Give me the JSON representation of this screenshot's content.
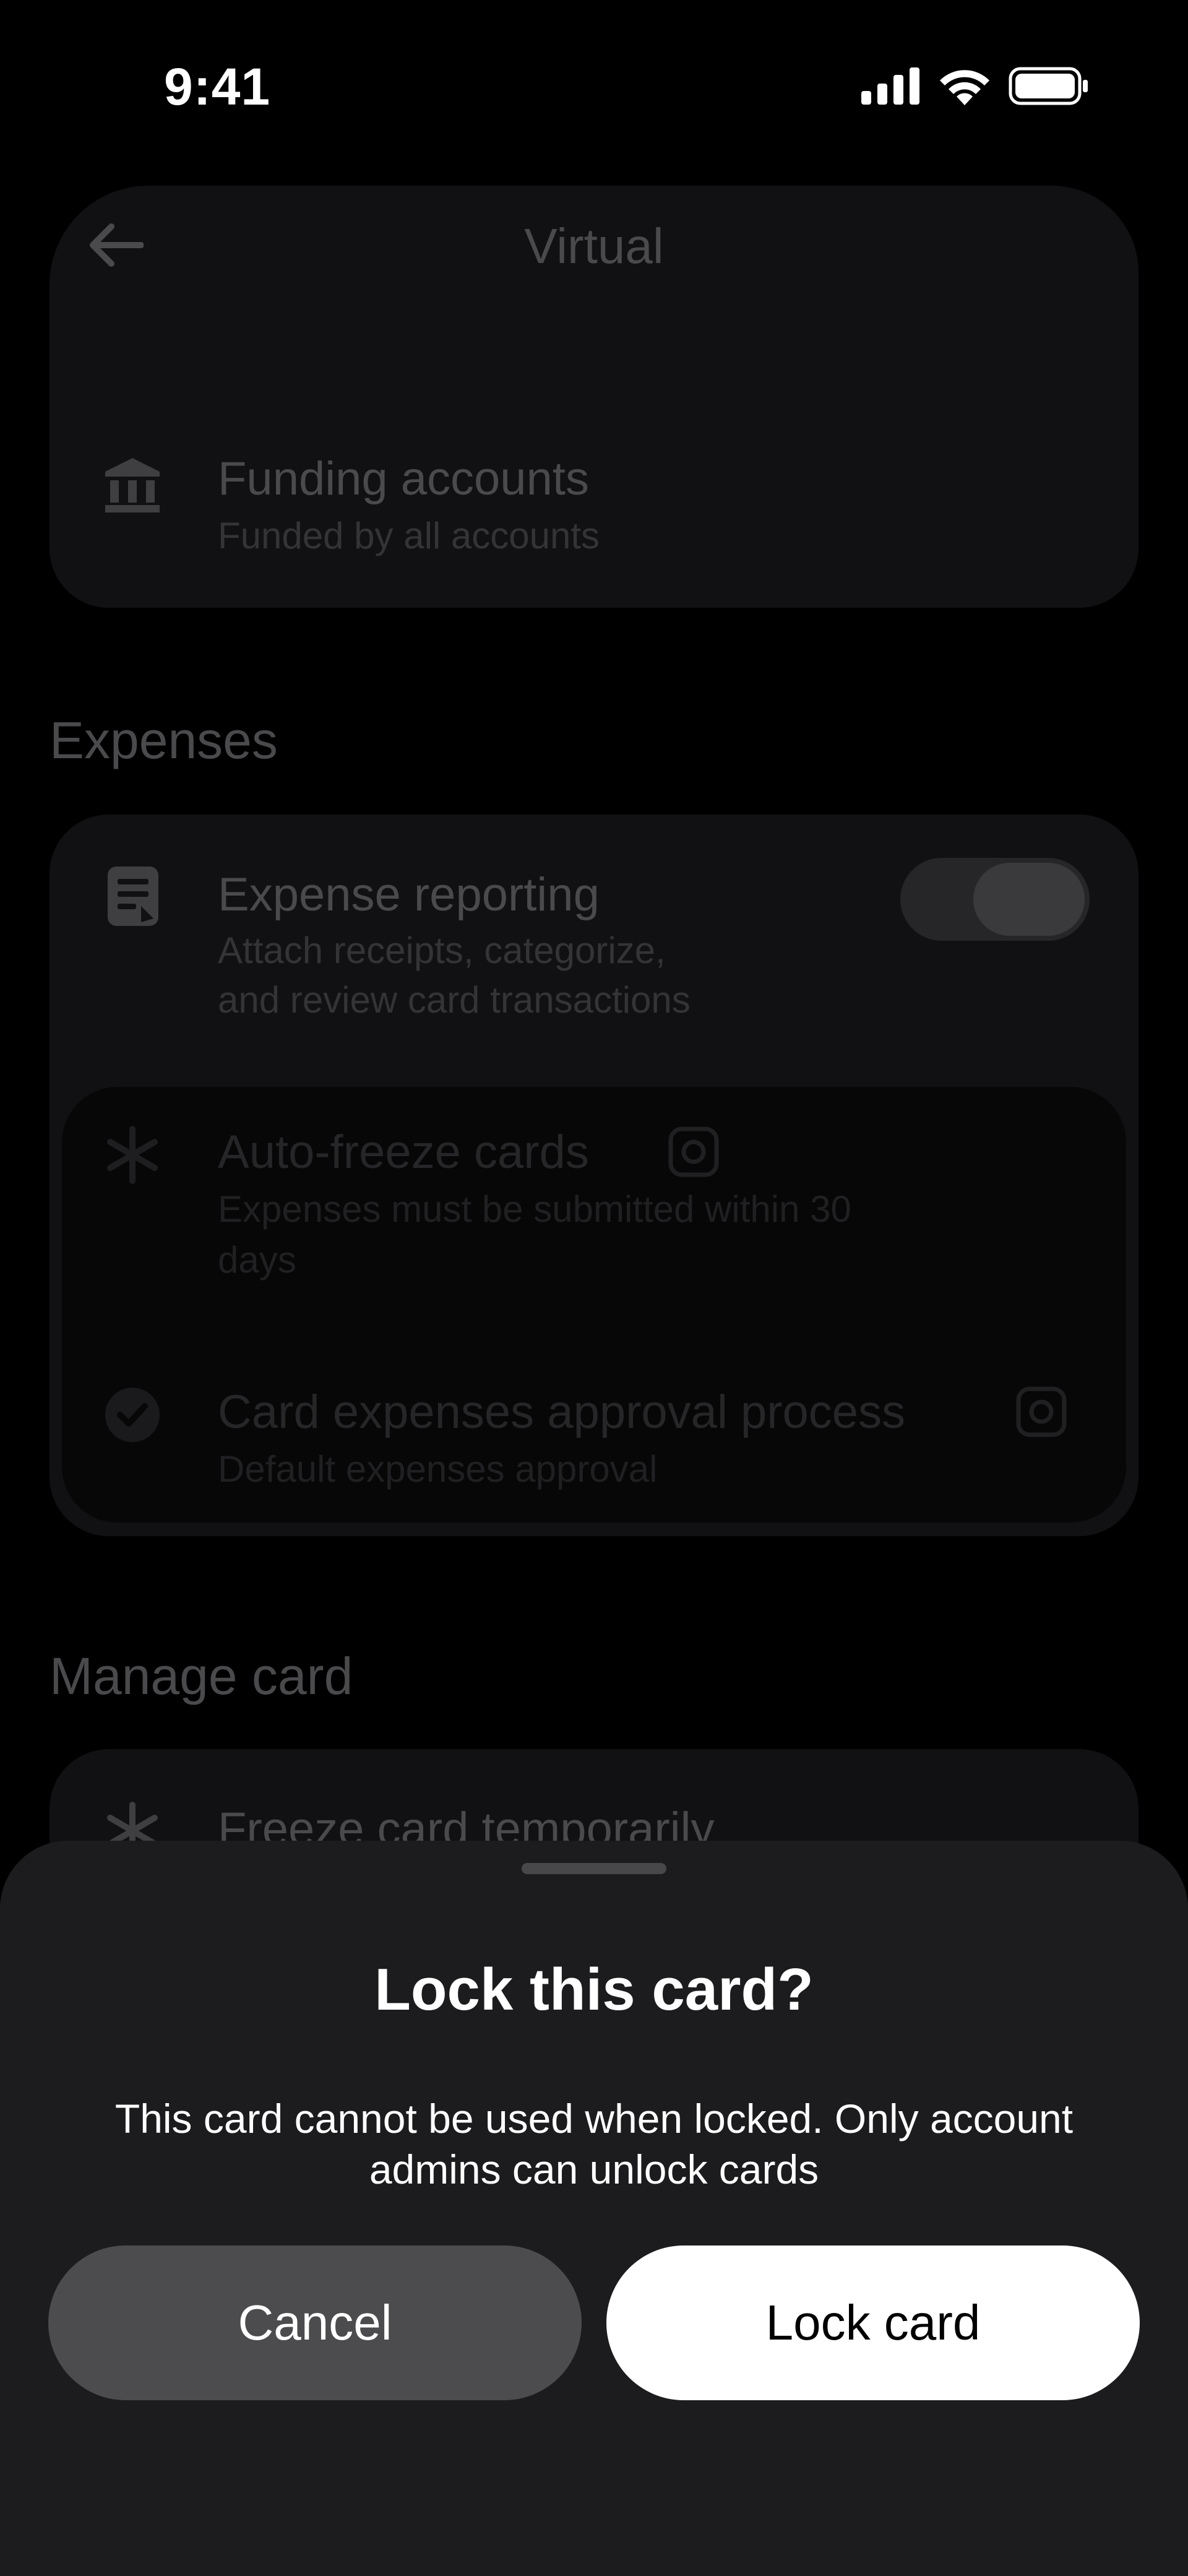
{
  "status_bar": {
    "time": "9:41"
  },
  "header": {
    "title": "Virtual",
    "back_icon": "arrow-left-icon"
  },
  "funding": {
    "icon": "bank-icon",
    "title": "Funding accounts",
    "subtitle": "Funded by all accounts"
  },
  "expenses": {
    "section_title": "Expenses",
    "reporting": {
      "icon": "receipt-icon",
      "title": "Expense reporting",
      "subtitle_line1": "Attach receipts, categorize,",
      "subtitle_line2": "and review card transactions",
      "enabled": true
    },
    "auto_freeze": {
      "icon": "snowflake-icon",
      "title": "Auto-freeze cards",
      "subtitle_line1": "Expenses must be submitted within 30",
      "subtitle_line2": "days"
    },
    "approval": {
      "icon": "check-circle-icon",
      "title": "Card expenses approval process",
      "subtitle": "Default expenses approval"
    }
  },
  "manage": {
    "section_title": "Manage card",
    "freeze": {
      "icon": "snowflake-icon",
      "title": "Freeze card temporarily"
    }
  },
  "sheet": {
    "title": "Lock this card?",
    "body_line1": "This card cannot be used when locked. Only account",
    "body_line2": "admins can unlock cards",
    "cancel_label": "Cancel",
    "confirm_label": "Lock card"
  },
  "colors": {
    "background": "#000000",
    "sheet": "#1c1c1e",
    "cancel_button": "#4c4c4f",
    "confirm_button": "#ffffff"
  }
}
